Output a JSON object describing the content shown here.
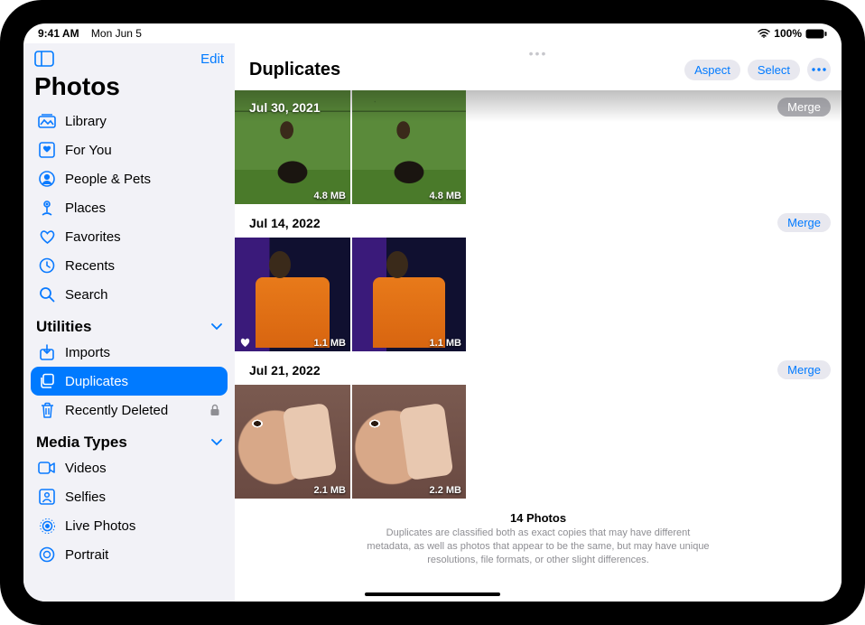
{
  "statusbar": {
    "time": "9:41 AM",
    "date": "Mon Jun 5",
    "battery": "100%"
  },
  "sidebar": {
    "edit_label": "Edit",
    "title": "Photos",
    "items": [
      {
        "label": "Library",
        "icon": "library-icon"
      },
      {
        "label": "For You",
        "icon": "foryou-icon"
      },
      {
        "label": "People & Pets",
        "icon": "people-icon"
      },
      {
        "label": "Places",
        "icon": "places-icon"
      },
      {
        "label": "Favorites",
        "icon": "heart-icon"
      },
      {
        "label": "Recents",
        "icon": "clock-icon"
      },
      {
        "label": "Search",
        "icon": "search-icon"
      }
    ],
    "utilities": {
      "title": "Utilities",
      "items": [
        {
          "label": "Imports",
          "icon": "import-icon"
        },
        {
          "label": "Duplicates",
          "icon": "duplicates-icon",
          "selected": true
        },
        {
          "label": "Recently Deleted",
          "icon": "trash-icon",
          "locked": true
        }
      ]
    },
    "media": {
      "title": "Media Types",
      "items": [
        {
          "label": "Videos",
          "icon": "video-icon"
        },
        {
          "label": "Selfies",
          "icon": "selfie-icon"
        },
        {
          "label": "Live Photos",
          "icon": "live-icon"
        },
        {
          "label": "Portrait",
          "icon": "portrait-icon"
        }
      ]
    }
  },
  "main": {
    "title": "Duplicates",
    "buttons": {
      "aspect": "Aspect",
      "select": "Select"
    }
  },
  "groups": [
    {
      "date": "Jul 30, 2021",
      "merge": "Merge",
      "thumbs": [
        {
          "size": "4.8 MB"
        },
        {
          "size": "4.8 MB"
        }
      ]
    },
    {
      "date": "Jul 14, 2022",
      "merge": "Merge",
      "thumbs": [
        {
          "size": "1.1 MB",
          "fav": true
        },
        {
          "size": "1.1 MB"
        }
      ]
    },
    {
      "date": "Jul 21, 2022",
      "merge": "Merge",
      "thumbs": [
        {
          "size": "2.1 MB"
        },
        {
          "size": "2.2 MB"
        }
      ]
    }
  ],
  "footer": {
    "count": "14 Photos",
    "desc": "Duplicates are classified both as exact copies that may have different metadata, as well as photos that appear to be the same, but may have unique resolutions, file formats, or other slight differences."
  }
}
